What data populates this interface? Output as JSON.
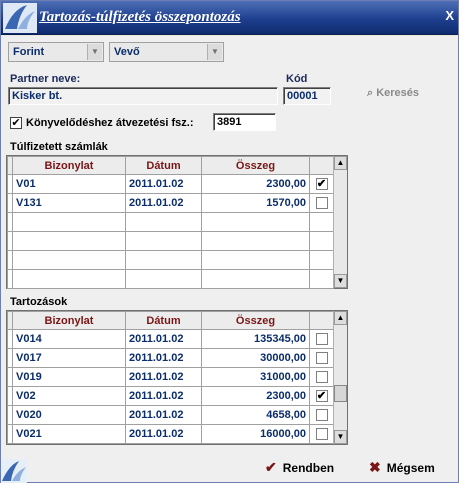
{
  "window": {
    "title": "Tartozás-túlfizetés összepontozás",
    "close": "X"
  },
  "currency_select": {
    "value": "Forint"
  },
  "partner_type_select": {
    "value": "Vevő"
  },
  "partner": {
    "name_label": "Partner neve:",
    "name": "Kisker bt.",
    "code_label": "Kód",
    "code": "00001",
    "search_label": "Keresés"
  },
  "ledger": {
    "checked": true,
    "label": "Könyvelődéshez átvezetési fsz.:",
    "value": "3891"
  },
  "overpaid": {
    "title": "Túlfizetett számlák",
    "columns": [
      "Bizonylat",
      "Dátum",
      "Összeg"
    ],
    "rows": [
      {
        "doc": "V01",
        "date": "2011.01.02",
        "amount": "2300,00",
        "checked": true
      },
      {
        "doc": "V131",
        "date": "2011.01.02",
        "amount": "1570,00",
        "checked": false
      }
    ]
  },
  "debts": {
    "title": "Tartozások",
    "columns": [
      "Bizonylat",
      "Dátum",
      "Összeg"
    ],
    "rows": [
      {
        "doc": "V014",
        "date": "2011.01.02",
        "amount": "135345,00",
        "checked": false
      },
      {
        "doc": "V017",
        "date": "2011.01.02",
        "amount": "30000,00",
        "checked": false
      },
      {
        "doc": "V019",
        "date": "2011.01.02",
        "amount": "31000,00",
        "checked": false
      },
      {
        "doc": "V02",
        "date": "2011.01.02",
        "amount": "2300,00",
        "checked": true
      },
      {
        "doc": "V020",
        "date": "2011.01.02",
        "amount": "4658,00",
        "checked": false
      },
      {
        "doc": "V021",
        "date": "2011.01.02",
        "amount": "16000,00",
        "checked": false
      }
    ]
  },
  "buttons": {
    "ok": "Rendben",
    "cancel": "Mégsem"
  },
  "icons": {
    "check": "✔",
    "ok_icon": "checkmark-icon",
    "cancel_icon": "x-icon"
  }
}
